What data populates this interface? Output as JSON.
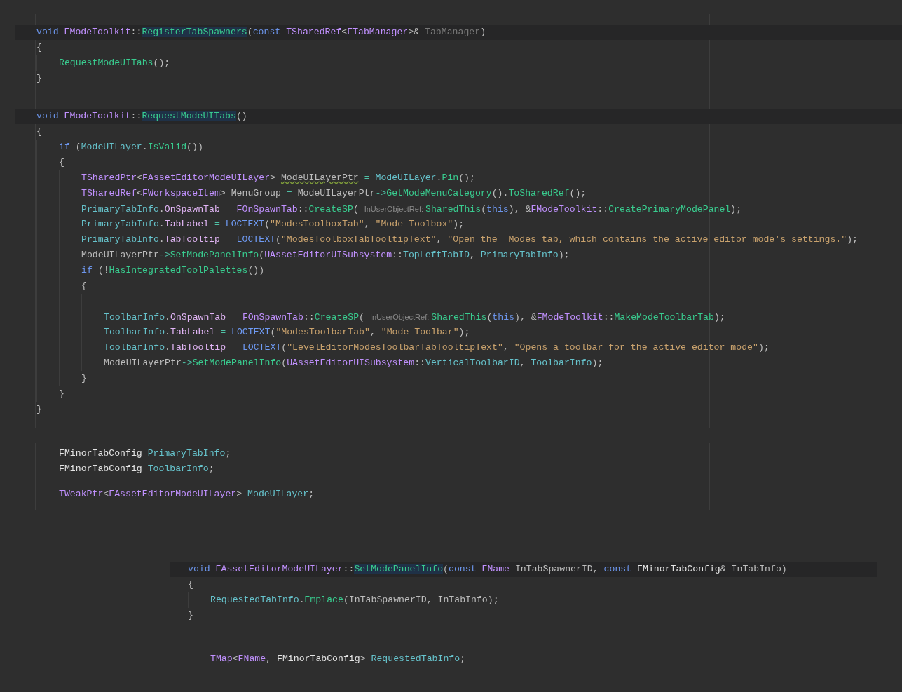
{
  "panels": [
    {
      "blocks": [
        {
          "lines": [
            {
              "current": true,
              "tokens": [
                {
                  "kind": "kw",
                  "text": "void "
                },
                {
                  "kind": "type",
                  "text": "FModeToolkit"
                },
                {
                  "kind": "plain",
                  "text": "::"
                },
                {
                  "kind": "decl",
                  "text": "RegisterTabSpawners"
                },
                {
                  "kind": "plain",
                  "text": "("
                },
                {
                  "kind": "kw",
                  "text": "const "
                },
                {
                  "kind": "type",
                  "text": "TSharedRef"
                },
                {
                  "kind": "plain",
                  "text": "<"
                },
                {
                  "kind": "type",
                  "text": "FTabManager"
                },
                {
                  "kind": "plain",
                  "text": ">& "
                },
                {
                  "kind": "unused",
                  "text": "TabManager"
                },
                {
                  "kind": "plain",
                  "text": ")"
                }
              ]
            },
            {
              "current": false,
              "tokens": [
                {
                  "kind": "plain",
                  "text": "{"
                }
              ],
              "children": [
                {
                  "current": false,
                  "tokens": [
                    {
                      "kind": "fn",
                      "text": "RequestModeUITabs"
                    },
                    {
                      "kind": "plain",
                      "text": "();"
                    }
                  ]
                }
              ]
            },
            {
              "current": false,
              "tokens": [
                {
                  "kind": "plain",
                  "text": "}"
                }
              ]
            }
          ]
        },
        {
          "lines": [
            {
              "current": true,
              "tokens": [
                {
                  "kind": "kw",
                  "text": "void "
                },
                {
                  "kind": "type",
                  "text": "FModeToolkit"
                },
                {
                  "kind": "plain",
                  "text": "::"
                },
                {
                  "kind": "decl",
                  "text": "RequestModeUITabs"
                },
                {
                  "kind": "plain",
                  "text": "()"
                }
              ]
            },
            {
              "current": false,
              "tokens": [
                {
                  "kind": "plain",
                  "text": "{"
                }
              ],
              "children": [
                {
                  "current": false,
                  "tokens": [
                    {
                      "kind": "kw",
                      "text": "if "
                    },
                    {
                      "kind": "plain",
                      "text": "("
                    },
                    {
                      "kind": "field",
                      "text": "ModeUILayer"
                    },
                    {
                      "kind": "plain",
                      "text": "."
                    },
                    {
                      "kind": "fn",
                      "text": "IsValid"
                    },
                    {
                      "kind": "plain",
                      "text": "())"
                    }
                  ]
                },
                {
                  "current": false,
                  "tokens": [
                    {
                      "kind": "plain",
                      "text": "{"
                    }
                  ],
                  "children": [
                    {
                      "current": false,
                      "tokens": [
                        {
                          "kind": "type",
                          "text": "TSharedPtr"
                        },
                        {
                          "kind": "plain",
                          "text": "<"
                        },
                        {
                          "kind": "type",
                          "text": "FAssetEditorModeUILayer"
                        },
                        {
                          "kind": "plain",
                          "text": "> "
                        },
                        {
                          "kind": "warn",
                          "text": "ModeUILayerPtr"
                        },
                        {
                          "kind": "op",
                          "text": " = "
                        },
                        {
                          "kind": "field",
                          "text": "ModeUILayer"
                        },
                        {
                          "kind": "plain",
                          "text": "."
                        },
                        {
                          "kind": "fn",
                          "text": "Pin"
                        },
                        {
                          "kind": "plain",
                          "text": "();"
                        }
                      ]
                    },
                    {
                      "current": false,
                      "tokens": [
                        {
                          "kind": "type",
                          "text": "TSharedRef"
                        },
                        {
                          "kind": "plain",
                          "text": "<"
                        },
                        {
                          "kind": "type",
                          "text": "FWorkspaceItem"
                        },
                        {
                          "kind": "plain",
                          "text": "> MenuGroup "
                        },
                        {
                          "kind": "op",
                          "text": "= "
                        },
                        {
                          "kind": "plain",
                          "text": "ModeUILayerPtr"
                        },
                        {
                          "kind": "op",
                          "text": "->"
                        },
                        {
                          "kind": "fn",
                          "text": "GetModeMenuCategory"
                        },
                        {
                          "kind": "plain",
                          "text": "()."
                        },
                        {
                          "kind": "fn",
                          "text": "ToSharedRef"
                        },
                        {
                          "kind": "plain",
                          "text": "();"
                        }
                      ]
                    },
                    {
                      "current": false,
                      "tokens": [
                        {
                          "kind": "field",
                          "text": "PrimaryTabInfo"
                        },
                        {
                          "kind": "plain",
                          "text": "."
                        },
                        {
                          "kind": "member",
                          "text": "OnSpawnTab"
                        },
                        {
                          "kind": "op",
                          "text": " = "
                        },
                        {
                          "kind": "type",
                          "text": "FOnSpawnTab"
                        },
                        {
                          "kind": "plain",
                          "text": "::"
                        },
                        {
                          "kind": "fn",
                          "text": "CreateSP"
                        },
                        {
                          "kind": "plain",
                          "text": "( "
                        },
                        {
                          "kind": "hint",
                          "text": "InUserObjectRef:"
                        },
                        {
                          "kind": "fn",
                          "text": "SharedThis"
                        },
                        {
                          "kind": "plain",
                          "text": "("
                        },
                        {
                          "kind": "kw",
                          "text": "this"
                        },
                        {
                          "kind": "plain",
                          "text": "), &"
                        },
                        {
                          "kind": "type",
                          "text": "FModeToolkit"
                        },
                        {
                          "kind": "plain",
                          "text": "::"
                        },
                        {
                          "kind": "fn",
                          "text": "CreatePrimaryModePanel"
                        },
                        {
                          "kind": "plain",
                          "text": ");"
                        }
                      ]
                    },
                    {
                      "current": false,
                      "tokens": [
                        {
                          "kind": "field",
                          "text": "PrimaryTabInfo"
                        },
                        {
                          "kind": "plain",
                          "text": "."
                        },
                        {
                          "kind": "member",
                          "text": "TabLabel"
                        },
                        {
                          "kind": "op",
                          "text": " = "
                        },
                        {
                          "kind": "macro",
                          "text": "LOCTEXT"
                        },
                        {
                          "kind": "plain",
                          "text": "("
                        },
                        {
                          "kind": "str",
                          "text": "\"ModesToolboxTab\""
                        },
                        {
                          "kind": "plain",
                          "text": ", "
                        },
                        {
                          "kind": "str",
                          "text": "\"Mode Toolbox\""
                        },
                        {
                          "kind": "plain",
                          "text": ");"
                        }
                      ]
                    },
                    {
                      "current": false,
                      "tokens": [
                        {
                          "kind": "field",
                          "text": "PrimaryTabInfo"
                        },
                        {
                          "kind": "plain",
                          "text": "."
                        },
                        {
                          "kind": "member",
                          "text": "TabTooltip"
                        },
                        {
                          "kind": "op",
                          "text": " = "
                        },
                        {
                          "kind": "macro",
                          "text": "LOCTEXT"
                        },
                        {
                          "kind": "plain",
                          "text": "("
                        },
                        {
                          "kind": "str",
                          "text": "\"ModesToolboxTabTooltipText\""
                        },
                        {
                          "kind": "plain",
                          "text": ", "
                        },
                        {
                          "kind": "str",
                          "text": "\"Open the  Modes tab, which contains the active editor mode's settings.\""
                        },
                        {
                          "kind": "plain",
                          "text": ");"
                        }
                      ]
                    },
                    {
                      "current": false,
                      "tokens": [
                        {
                          "kind": "plain",
                          "text": "ModeUILayerPtr"
                        },
                        {
                          "kind": "op",
                          "text": "->"
                        },
                        {
                          "kind": "fn",
                          "text": "SetModePanelInfo"
                        },
                        {
                          "kind": "plain",
                          "text": "("
                        },
                        {
                          "kind": "type",
                          "text": "UAssetEditorUISubsystem"
                        },
                        {
                          "kind": "plain",
                          "text": "::"
                        },
                        {
                          "kind": "field",
                          "text": "TopLeftTabID"
                        },
                        {
                          "kind": "plain",
                          "text": ", "
                        },
                        {
                          "kind": "field",
                          "text": "PrimaryTabInfo"
                        },
                        {
                          "kind": "plain",
                          "text": ");"
                        }
                      ]
                    },
                    {
                      "current": false,
                      "tokens": [
                        {
                          "kind": "kw",
                          "text": "if "
                        },
                        {
                          "kind": "plain",
                          "text": "(!"
                        },
                        {
                          "kind": "fn",
                          "text": "HasIntegratedToolPalettes"
                        },
                        {
                          "kind": "plain",
                          "text": "())"
                        }
                      ]
                    },
                    {
                      "current": false,
                      "tokens": [
                        {
                          "kind": "plain",
                          "text": "{"
                        }
                      ],
                      "children": [
                        {
                          "current": false
                        },
                        {
                          "current": false,
                          "tokens": [
                            {
                              "kind": "field",
                              "text": "ToolbarInfo"
                            },
                            {
                              "kind": "plain",
                              "text": "."
                            },
                            {
                              "kind": "member",
                              "text": "OnSpawnTab"
                            },
                            {
                              "kind": "op",
                              "text": " = "
                            },
                            {
                              "kind": "type",
                              "text": "FOnSpawnTab"
                            },
                            {
                              "kind": "plain",
                              "text": "::"
                            },
                            {
                              "kind": "fn",
                              "text": "CreateSP"
                            },
                            {
                              "kind": "plain",
                              "text": "( "
                            },
                            {
                              "kind": "hint",
                              "text": "InUserObjectRef:"
                            },
                            {
                              "kind": "fn",
                              "text": "SharedThis"
                            },
                            {
                              "kind": "plain",
                              "text": "("
                            },
                            {
                              "kind": "kw",
                              "text": "this"
                            },
                            {
                              "kind": "plain",
                              "text": "), &"
                            },
                            {
                              "kind": "type",
                              "text": "FModeToolkit"
                            },
                            {
                              "kind": "plain",
                              "text": "::"
                            },
                            {
                              "kind": "fn",
                              "text": "MakeModeToolbarTab"
                            },
                            {
                              "kind": "plain",
                              "text": ");"
                            }
                          ]
                        },
                        {
                          "current": false,
                          "tokens": [
                            {
                              "kind": "field",
                              "text": "ToolbarInfo"
                            },
                            {
                              "kind": "plain",
                              "text": "."
                            },
                            {
                              "kind": "member",
                              "text": "TabLabel"
                            },
                            {
                              "kind": "op",
                              "text": " = "
                            },
                            {
                              "kind": "macro",
                              "text": "LOCTEXT"
                            },
                            {
                              "kind": "plain",
                              "text": "("
                            },
                            {
                              "kind": "str",
                              "text": "\"ModesToolbarTab\""
                            },
                            {
                              "kind": "plain",
                              "text": ", "
                            },
                            {
                              "kind": "str",
                              "text": "\"Mode Toolbar\""
                            },
                            {
                              "kind": "plain",
                              "text": ");"
                            }
                          ]
                        },
                        {
                          "current": false,
                          "tokens": [
                            {
                              "kind": "field",
                              "text": "ToolbarInfo"
                            },
                            {
                              "kind": "plain",
                              "text": "."
                            },
                            {
                              "kind": "member",
                              "text": "TabTooltip"
                            },
                            {
                              "kind": "op",
                              "text": " = "
                            },
                            {
                              "kind": "macro",
                              "text": "LOCTEXT"
                            },
                            {
                              "kind": "plain",
                              "text": "("
                            },
                            {
                              "kind": "str",
                              "text": "\"LevelEditorModesToolbarTabTooltipText\""
                            },
                            {
                              "kind": "plain",
                              "text": ", "
                            },
                            {
                              "kind": "str",
                              "text": "\"Opens a toolbar for the active editor mode\""
                            },
                            {
                              "kind": "plain",
                              "text": ");"
                            }
                          ]
                        },
                        {
                          "current": false,
                          "tokens": [
                            {
                              "kind": "plain",
                              "text": "ModeUILayerPtr"
                            },
                            {
                              "kind": "op",
                              "text": "->"
                            },
                            {
                              "kind": "fn",
                              "text": "SetModePanelInfo"
                            },
                            {
                              "kind": "plain",
                              "text": "("
                            },
                            {
                              "kind": "type",
                              "text": "UAssetEditorUISubsystem"
                            },
                            {
                              "kind": "plain",
                              "text": "::"
                            },
                            {
                              "kind": "field",
                              "text": "VerticalToolbarID"
                            },
                            {
                              "kind": "plain",
                              "text": ", "
                            },
                            {
                              "kind": "field",
                              "text": "ToolbarInfo"
                            },
                            {
                              "kind": "plain",
                              "text": ");"
                            }
                          ]
                        }
                      ]
                    },
                    {
                      "current": false,
                      "tokens": [
                        {
                          "kind": "plain",
                          "text": "}"
                        }
                      ]
                    }
                  ]
                },
                {
                  "current": false,
                  "tokens": [
                    {
                      "kind": "plain",
                      "text": "}"
                    }
                  ]
                }
              ]
            },
            {
              "current": false,
              "tokens": [
                {
                  "kind": "plain",
                  "text": "}"
                }
              ]
            }
          ]
        }
      ]
    },
    {
      "blocks": [
        {
          "lines": [
            {
              "current": false,
              "tokens": [
                {
                  "kind": "struct",
                  "text": "FMinorTabConfig "
                },
                {
                  "kind": "field",
                  "text": "PrimaryTabInfo"
                },
                {
                  "kind": "plain",
                  "text": ";"
                }
              ]
            },
            {
              "current": false,
              "tokens": [
                {
                  "kind": "struct",
                  "text": "FMinorTabConfig "
                },
                {
                  "kind": "field",
                  "text": "ToolbarInfo"
                },
                {
                  "kind": "plain",
                  "text": ";"
                }
              ]
            }
          ]
        },
        {
          "lines": [
            {
              "current": false,
              "tokens": [
                {
                  "kind": "type",
                  "text": "TWeakPtr"
                },
                {
                  "kind": "plain",
                  "text": "<"
                },
                {
                  "kind": "type",
                  "text": "FAssetEditorModeUILayer"
                },
                {
                  "kind": "plain",
                  "text": "> "
                },
                {
                  "kind": "field",
                  "text": "ModeUILayer"
                },
                {
                  "kind": "plain",
                  "text": ";"
                }
              ]
            }
          ]
        }
      ]
    },
    {
      "blocks": [
        {
          "lines": [
            {
              "current": true,
              "tokens": [
                {
                  "kind": "kw",
                  "text": "void "
                },
                {
                  "kind": "type",
                  "text": "FAssetEditorModeUILayer"
                },
                {
                  "kind": "plain",
                  "text": "::"
                },
                {
                  "kind": "decl",
                  "text": "SetModePanelInfo"
                },
                {
                  "kind": "plain",
                  "text": "("
                },
                {
                  "kind": "kw",
                  "text": "const "
                },
                {
                  "kind": "type",
                  "text": "FName"
                },
                {
                  "kind": "plain",
                  "text": " InTabSpawnerID, "
                },
                {
                  "kind": "kw",
                  "text": "const "
                },
                {
                  "kind": "struct",
                  "text": "FMinorTabConfig"
                },
                {
                  "kind": "plain",
                  "text": "& InTabInfo)"
                }
              ]
            },
            {
              "current": false,
              "tokens": [
                {
                  "kind": "plain",
                  "text": "{"
                }
              ],
              "children": [
                {
                  "current": false,
                  "tokens": [
                    {
                      "kind": "field",
                      "text": "RequestedTabInfo"
                    },
                    {
                      "kind": "plain",
                      "text": "."
                    },
                    {
                      "kind": "fn",
                      "text": "Emplace"
                    },
                    {
                      "kind": "plain",
                      "text": "(InTabSpawnerID, InTabInfo);"
                    }
                  ]
                }
              ]
            },
            {
              "current": false,
              "tokens": [
                {
                  "kind": "plain",
                  "text": "}"
                }
              ]
            }
          ]
        },
        {
          "lines": [
            {
              "current": false,
              "tokens": [
                {
                  "kind": "type",
                  "text": "TMap"
                },
                {
                  "kind": "plain",
                  "text": "<"
                },
                {
                  "kind": "type",
                  "text": "FName"
                },
                {
                  "kind": "plain",
                  "text": ", "
                },
                {
                  "kind": "struct",
                  "text": "FMinorTabConfig"
                },
                {
                  "kind": "plain",
                  "text": "> "
                },
                {
                  "kind": "field",
                  "text": "RequestedTabInfo"
                },
                {
                  "kind": "plain",
                  "text": ";"
                }
              ]
            }
          ]
        }
      ]
    }
  ]
}
